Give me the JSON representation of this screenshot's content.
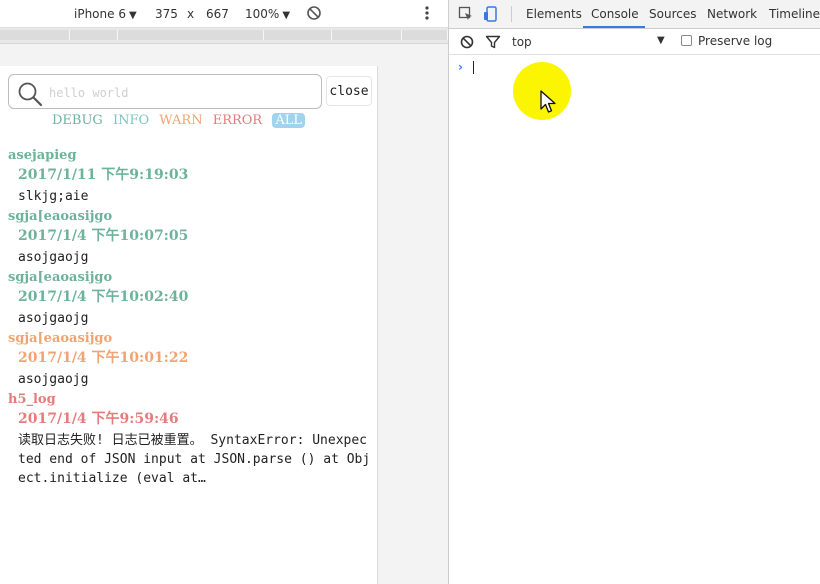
{
  "device_toolbar": {
    "device": "iPhone 6",
    "width": "375",
    "times": "x",
    "height": "667",
    "zoom": "100%"
  },
  "log_viewer": {
    "search_placeholder": "hello world",
    "close_label": "close",
    "levels": {
      "debug": "DEBUG",
      "info": "INFO",
      "warn": "WARN",
      "error": "ERROR",
      "all": "ALL"
    },
    "level_colors": {
      "debug": "#6db39a",
      "info": "#78c6c4",
      "warn": "#f1a472",
      "error": "#e57c7c",
      "all": "#9fd3ee"
    },
    "entries": [
      {
        "tag": "asejapieg",
        "time": "2017/1/11 下午9:19:03",
        "message": "slkjg;aie",
        "level": "debug",
        "color": "#6db39a"
      },
      {
        "tag": "sgja[eaoasijgo",
        "time": "2017/1/4 下午10:07:05",
        "message": "asojgaojg",
        "level": "debug",
        "color": "#6db39a"
      },
      {
        "tag": "sgja[eaoasijgo",
        "time": "2017/1/4 下午10:02:40",
        "message": "asojgaojg",
        "level": "debug",
        "color": "#6db39a"
      },
      {
        "tag": "sgja[eaoasijgo",
        "time": "2017/1/4 下午10:01:22",
        "message": "asojgaojg",
        "level": "warn",
        "color": "#f1a472"
      },
      {
        "tag": "h5_log",
        "time": "2017/1/4 下午9:59:46",
        "message": "读取日志失败! 日志已被重置。 SyntaxError: Unexpected end of JSON input at JSON.parse () at Object.initialize (eval at…",
        "level": "error",
        "color": "#e57c7c"
      }
    ]
  },
  "devtools": {
    "tabs": [
      "Elements",
      "Console",
      "Sources",
      "Network",
      "Timeline"
    ],
    "active_tab": "Console",
    "context": "top",
    "preserve_log": "Preserve log",
    "prompt_symbol": "›"
  },
  "colors": {
    "accent": "#3879d9",
    "highlight": "#fbf600"
  }
}
